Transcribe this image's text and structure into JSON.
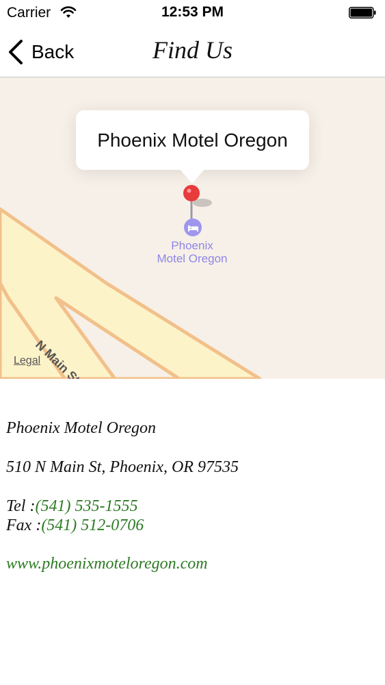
{
  "status_bar": {
    "carrier": "Carrier",
    "time": "12:53 PM"
  },
  "nav": {
    "back_label": "Back",
    "title": "Find Us"
  },
  "map": {
    "callout_title": "Phoenix Motel Oregon",
    "poi_label_line1": "Phoenix",
    "poi_label_line2": "Motel Oregon",
    "street_label": "N Main St",
    "legal_label": "Legal"
  },
  "info": {
    "name": "Phoenix Motel Oregon",
    "address": "510 N Main St, Phoenix, OR 97535",
    "tel_label": "Tel :",
    "tel_value": "(541) 535-1555",
    "fax_label": "Fax :",
    "fax_value": "(541) 512-0706",
    "website": "www.phoenixmoteloregon.com"
  },
  "colors": {
    "link_green": "#2d7a24",
    "map_background": "#f6f0e8",
    "road_fill": "#fdf3c9",
    "road_stroke": "#f2c08a",
    "poi_purple": "#8f86e6",
    "pin_red": "#e83b3b"
  },
  "icons": {
    "wifi": "wifi-icon",
    "battery": "battery-icon",
    "back": "chevron-left-icon",
    "pin": "map-pin-icon",
    "poi": "bed-icon"
  }
}
